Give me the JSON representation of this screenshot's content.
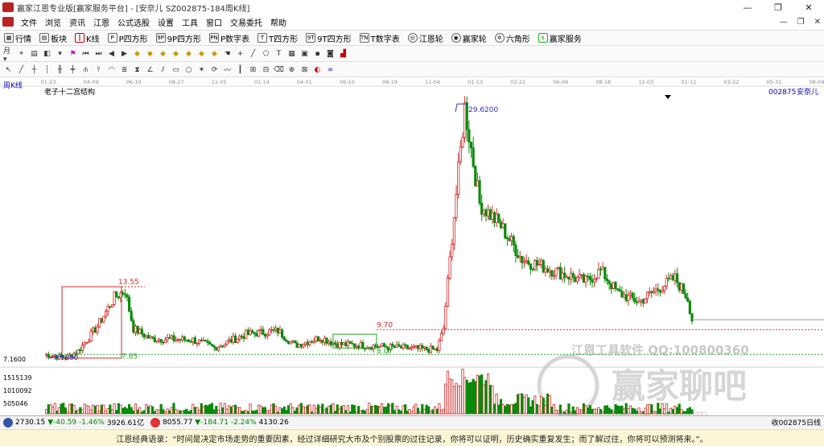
{
  "window": {
    "title": "赢家江恩专业版[赢家服务平台] - [安奈儿  SZ002875-184周K线]",
    "controls": [
      "—",
      "❐",
      "✕"
    ]
  },
  "menubar": {
    "items": [
      "文件",
      "浏览",
      "资讯",
      "江恩",
      "公式选股",
      "设置",
      "工具",
      "窗口",
      "交易委托",
      "帮助"
    ],
    "controls": [
      "—",
      "❐",
      "✕"
    ]
  },
  "toolbar": {
    "items": [
      {
        "icon": "grid-icon",
        "label": "行情"
      },
      {
        "icon": "blocks-icon",
        "label": "板块"
      },
      {
        "icon": "kline-icon",
        "label": "K线"
      },
      {
        "icon": "p-square-icon",
        "label": "P四方形"
      },
      {
        "icon": "9p-square-icon",
        "label": "9P四方形"
      },
      {
        "icon": "pn-square-icon",
        "label": "P数字表"
      },
      {
        "icon": "t-square-icon",
        "label": "T四方形"
      },
      {
        "icon": "9t-square-icon",
        "label": "9T四方形"
      },
      {
        "icon": "tn-square-icon",
        "label": "T数字表"
      },
      {
        "icon": "gann-wheel-icon",
        "label": "江恩轮"
      },
      {
        "icon": "winner-wheel-icon",
        "label": "赢家轮"
      },
      {
        "icon": "hexagon-icon",
        "label": "六角形"
      },
      {
        "icon": "service-icon",
        "label": "赢家服务"
      }
    ]
  },
  "chart_header": {
    "period_label": "周K线",
    "pattern_label": "老子十二宫结构",
    "stock_code": "002875",
    "stock_name": "安奈儿"
  },
  "chart_data": {
    "type": "candlestick",
    "date_ticks": [
      "01-23",
      "04-09",
      "06-10",
      "08-27",
      "11-05",
      "01-14",
      "04-01",
      "06-10",
      "08-19",
      "11-04",
      "01-13",
      "03-21",
      "06-09",
      "08-18",
      "11-03",
      "01-12",
      "03-22",
      "05-31",
      "08-09"
    ],
    "y_label_left": "7.1600",
    "annotations": {
      "high_peak": "29.6200",
      "box_top": "13.55",
      "box_low": "7.1600",
      "box_bottom": "7.85",
      "mid_top": "9.70",
      "mid_bottom": "8.07"
    },
    "volume_ticks": [
      "1515139",
      "1010092",
      "505046"
    ],
    "watermark_top": "江恩工具软件   QQ:100800360",
    "watermark_brand": "赢家聊吧",
    "watermark_url": "liaoba.yjcl.com",
    "colors": {
      "up": "#d22828",
      "down": "#0a8a0a",
      "line_red": "#ff3030",
      "line_green": "#22aa22",
      "box": "#d22828",
      "peak_line": "#3030c0"
    }
  },
  "statusbar": {
    "sh_index": "2730.15",
    "sh_change": "▼-40.59 -1.46%",
    "sh_amount": "3926.61亿",
    "sz_index": "8055.77",
    "sz_change": "▼-184.71 -2.24%",
    "sz_amount": "4130.26",
    "right_text": "收002875日线"
  },
  "quote": {
    "text": "江恩经典语录：“时间是决定市场走势的重要因素，经过详细研究大市及个别股票的过往记录，你将可以证明，历史确实重复发生；而了解过往，你将可以预测将来。”。"
  }
}
